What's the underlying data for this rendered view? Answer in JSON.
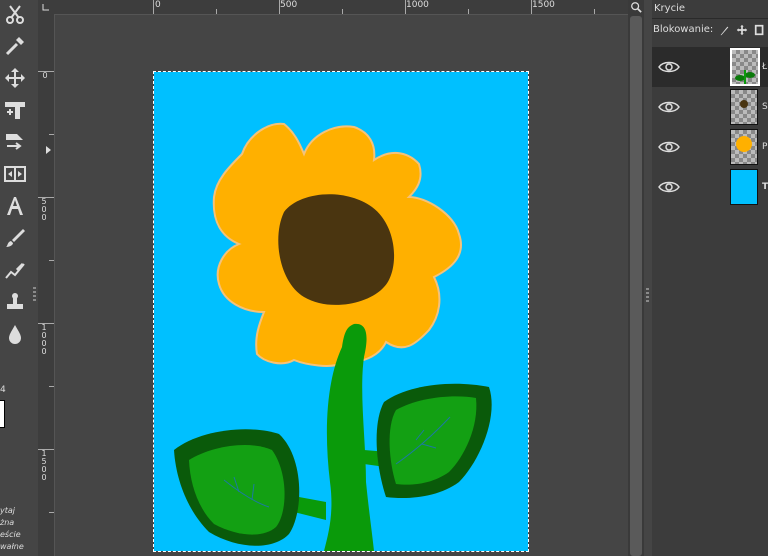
{
  "toolbox": {
    "tools": [
      {
        "name": "scissors-select-icon"
      },
      {
        "name": "color-picker-icon"
      },
      {
        "name": "move-tool-icon"
      },
      {
        "name": "crop-tool-icon"
      },
      {
        "name": "unified-transform-icon"
      },
      {
        "name": "flip-tool-icon"
      },
      {
        "name": "text-tool-icon"
      },
      {
        "name": "paintbrush-tool-icon"
      },
      {
        "name": "smudge-tool-icon"
      },
      {
        "name": "clone-tool-icon"
      },
      {
        "name": "blur-tool-icon"
      }
    ],
    "partial_number": "4",
    "options_fragments": [
      "ytaj",
      "żna",
      "eście",
      "wałne"
    ]
  },
  "rulers": {
    "horizontal": [
      "0",
      "500",
      "1000",
      "1500"
    ],
    "vertical": [
      "0",
      "500",
      "1000",
      "1500"
    ]
  },
  "layers_panel": {
    "tab_title": "Krycie",
    "lock_label": "Blokowanie:",
    "layers": [
      {
        "name_fragment": "Ł",
        "thumb": "leaves"
      },
      {
        "name_fragment": "Ś",
        "thumb": "center"
      },
      {
        "name_fragment": "P",
        "thumb": "petals"
      },
      {
        "name_fragment": "T",
        "thumb": "background"
      }
    ]
  },
  "colors": {
    "sky": "#00c0ff",
    "petals": "#ffb000",
    "center": "#4a3510",
    "stem": "#0a9a0a",
    "leaf_outline": "#0a5a0a",
    "leaf_fill": "#13a013"
  }
}
